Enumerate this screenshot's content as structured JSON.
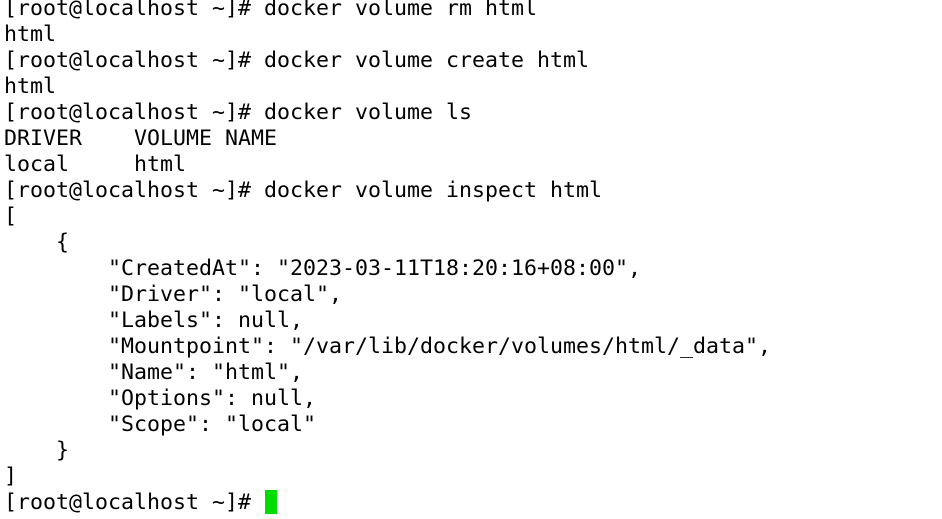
{
  "terminal": {
    "lines": [
      "[root@localhost ~]# docker volume rm html",
      "html",
      "[root@localhost ~]# docker volume create html",
      "html",
      "[root@localhost ~]# docker volume ls",
      "DRIVER    VOLUME NAME",
      "local     html",
      "[root@localhost ~]# docker volume inspect html",
      "[",
      "    {",
      "        \"CreatedAt\": \"2023-03-11T18:20:16+08:00\",",
      "        \"Driver\": \"local\",",
      "        \"Labels\": null,",
      "        \"Mountpoint\": \"/var/lib/docker/volumes/html/_data\",",
      "        \"Name\": \"html\",",
      "        \"Options\": null,",
      "        \"Scope\": \"local\"",
      "    }",
      "]"
    ],
    "prompt": "[root@localhost ~]# ",
    "cursor_color": "#00dd00"
  }
}
